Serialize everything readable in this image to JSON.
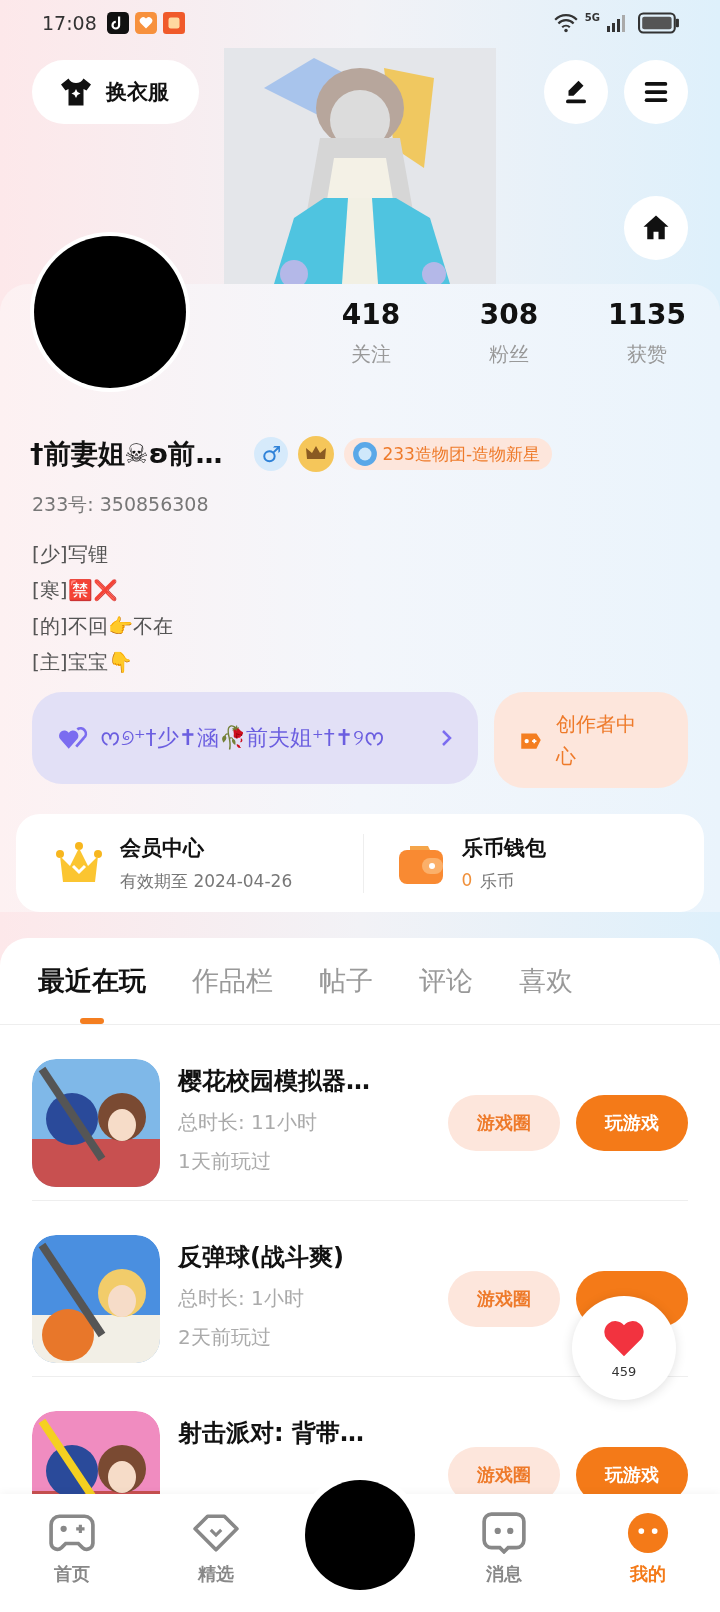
{
  "status_bar": {
    "time": "17:08",
    "network": "5G"
  },
  "header": {
    "dress_button": "换衣服"
  },
  "stats": [
    {
      "value": "418",
      "label": "关注"
    },
    {
      "value": "308",
      "label": "粉丝"
    },
    {
      "value": "1135",
      "label": "获赞"
    }
  ],
  "profile": {
    "name": "†前妻姐☠ʚ前…",
    "gender_symbol": "♂",
    "tag": "233造物团-造物新星",
    "id_line": "233号: 350856308",
    "bio": [
      "[少]写锂",
      "[寒]🈲❌",
      "[的]不回👉不在",
      "[主]宝宝👇"
    ]
  },
  "banner": {
    "text": "ᰔ୭⁺†少✝涵🥀前夫姐⁺†✝୨ᰔ"
  },
  "creator": {
    "label": "创作者中心"
  },
  "member": {
    "title": "会员中心",
    "subtitle": "有效期至 2024-04-26"
  },
  "wallet": {
    "title": "乐币钱包",
    "amount": "0",
    "unit": "乐币"
  },
  "tabs": [
    {
      "label": "最近在玩",
      "selected": true
    },
    {
      "label": "作品栏",
      "selected": false
    },
    {
      "label": "帖子",
      "selected": false
    },
    {
      "label": "评论",
      "selected": false
    },
    {
      "label": "喜欢",
      "selected": false
    }
  ],
  "games": [
    {
      "title": "樱花校园模拟器…",
      "duration": "总时长: 11小时",
      "last_played": "1天前玩过",
      "circle_button": "游戏圈",
      "play_button": "玩游戏"
    },
    {
      "title": "反弹球(战斗爽)",
      "duration": "总时长: 1小时",
      "last_played": "2天前玩过",
      "circle_button": "游戏圈"
    },
    {
      "title": "射击派对: 背带…",
      "circle_button": "游戏圈",
      "play_button": "玩游戏"
    }
  ],
  "like_bubble": {
    "count": "459"
  },
  "nav": [
    {
      "label": "首页",
      "kind": "home",
      "selected": false
    },
    {
      "label": "精选",
      "kind": "featured",
      "selected": false
    },
    {
      "kind": "center",
      "selected": false
    },
    {
      "label": "消息",
      "kind": "message",
      "selected": false
    },
    {
      "label": "我的",
      "kind": "me",
      "selected": true
    }
  ]
}
